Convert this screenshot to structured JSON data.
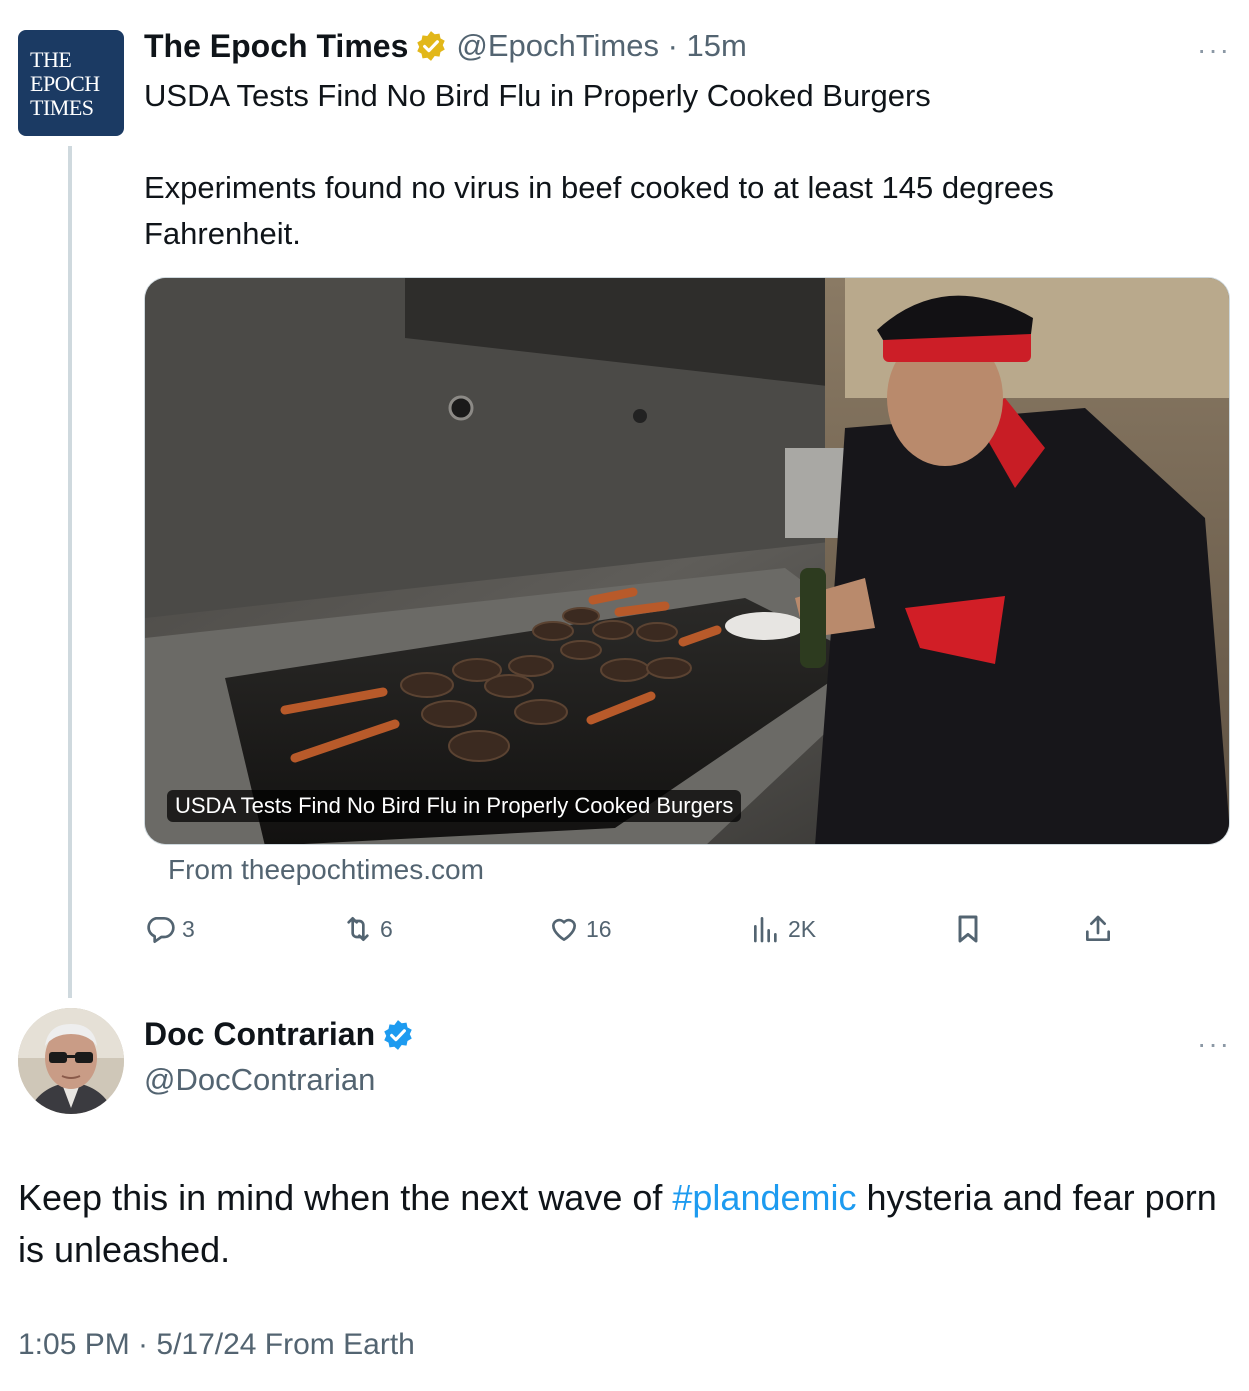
{
  "parent_tweet": {
    "avatar_lines": [
      "THE",
      "EPOCH",
      "TIMES"
    ],
    "name": "The Epoch Times",
    "badge_color": "#e2b719",
    "handle_time": "@EpochTimes · 15m",
    "more": "···",
    "text_line1": "USDA Tests Find No Bird Flu in Properly Cooked Burgers",
    "text_line2": "Experiments found no virus in beef cooked to at least 145 degrees",
    "text_line3": "Fahrenheit.",
    "card": {
      "caption": "USDA Tests Find No Bird Flu in Properly Cooked Burgers",
      "source": "From theepochtimes.com"
    },
    "actions": {
      "replies": "3",
      "reposts": "6",
      "likes": "16",
      "views": "2K"
    }
  },
  "main_tweet": {
    "name": "Doc Contrarian",
    "badge_color": "#1d9bf0",
    "handle": "@DocContrarian",
    "more": "···",
    "text_before": "Keep this in mind when the next wave of ",
    "hashtag": "#plandemic",
    "text_after": " hysteria and fear porn  is unleashed.",
    "meta": "1:05 PM · 5/17/24 From Earth"
  }
}
